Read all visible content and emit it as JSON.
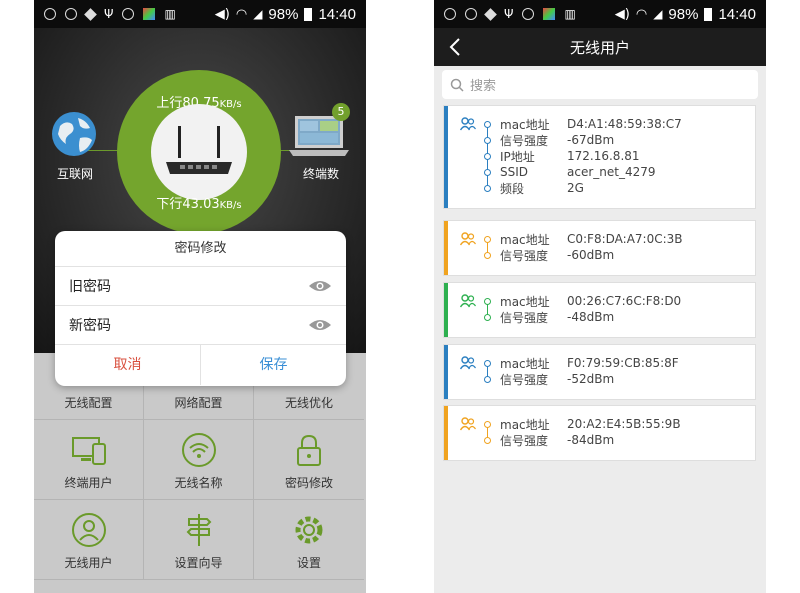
{
  "left": {
    "statusbar": {
      "battery": "98%",
      "time": "14:40"
    },
    "upload_label": "上行",
    "upload_value": "80.75",
    "upload_unit": "KB/s",
    "download_label": "下行",
    "download_value": "43.03",
    "download_unit": "KB/s",
    "internet_label": "互联网",
    "terminal_label": "终端数",
    "terminal_count": "5",
    "dialog": {
      "title": "密码修改",
      "old_password_label": "旧密码",
      "new_password_label": "新密码",
      "cancel_label": "取消",
      "save_label": "保存"
    },
    "grid": [
      {
        "label": "无线配置",
        "icon": "wifi-config-icon"
      },
      {
        "label": "网络配置",
        "icon": "globe-icon"
      },
      {
        "label": "无线优化",
        "icon": "rocket-icon"
      },
      {
        "label": "终端用户",
        "icon": "devices-icon"
      },
      {
        "label": "无线名称",
        "icon": "wifi-icon"
      },
      {
        "label": "密码修改",
        "icon": "lock-icon"
      },
      {
        "label": "无线用户",
        "icon": "user-icon"
      },
      {
        "label": "设置向导",
        "icon": "signpost-icon"
      },
      {
        "label": "设置",
        "icon": "gear-icon"
      }
    ]
  },
  "right": {
    "statusbar": {
      "battery": "98%",
      "time": "14:40"
    },
    "title": "无线用户",
    "search_placeholder": "搜索",
    "cards": [
      {
        "color": "#2b7fc0",
        "rows": [
          {
            "k": "mac地址",
            "v": "D4:A1:48:59:38:C7"
          },
          {
            "k": "信号强度",
            "v": "-67dBm"
          },
          {
            "k": "IP地址",
            "v": "172.16.8.81"
          },
          {
            "k": "SSID",
            "v": "acer_net_4279"
          },
          {
            "k": "频段",
            "v": "2G"
          }
        ]
      },
      {
        "color": "#f0a320",
        "rows": [
          {
            "k": "mac地址",
            "v": "C0:F8:DA:A7:0C:3B"
          },
          {
            "k": "信号强度",
            "v": "-60dBm"
          }
        ]
      },
      {
        "color": "#2eb050",
        "rows": [
          {
            "k": "mac地址",
            "v": "00:26:C7:6C:F8:D0"
          },
          {
            "k": "信号强度",
            "v": "-48dBm"
          }
        ]
      },
      {
        "color": "#2b7fc0",
        "rows": [
          {
            "k": "mac地址",
            "v": "F0:79:59:CB:85:8F"
          },
          {
            "k": "信号强度",
            "v": "-52dBm"
          }
        ]
      },
      {
        "color": "#f0a320",
        "rows": [
          {
            "k": "mac地址",
            "v": "20:A2:E4:5B:55:9B"
          },
          {
            "k": "信号强度",
            "v": "-84dBm"
          }
        ]
      }
    ]
  },
  "colors": {
    "accent_green": "#74a52d",
    "save_blue": "#3a8fd6",
    "cancel_red": "#d9503f"
  }
}
